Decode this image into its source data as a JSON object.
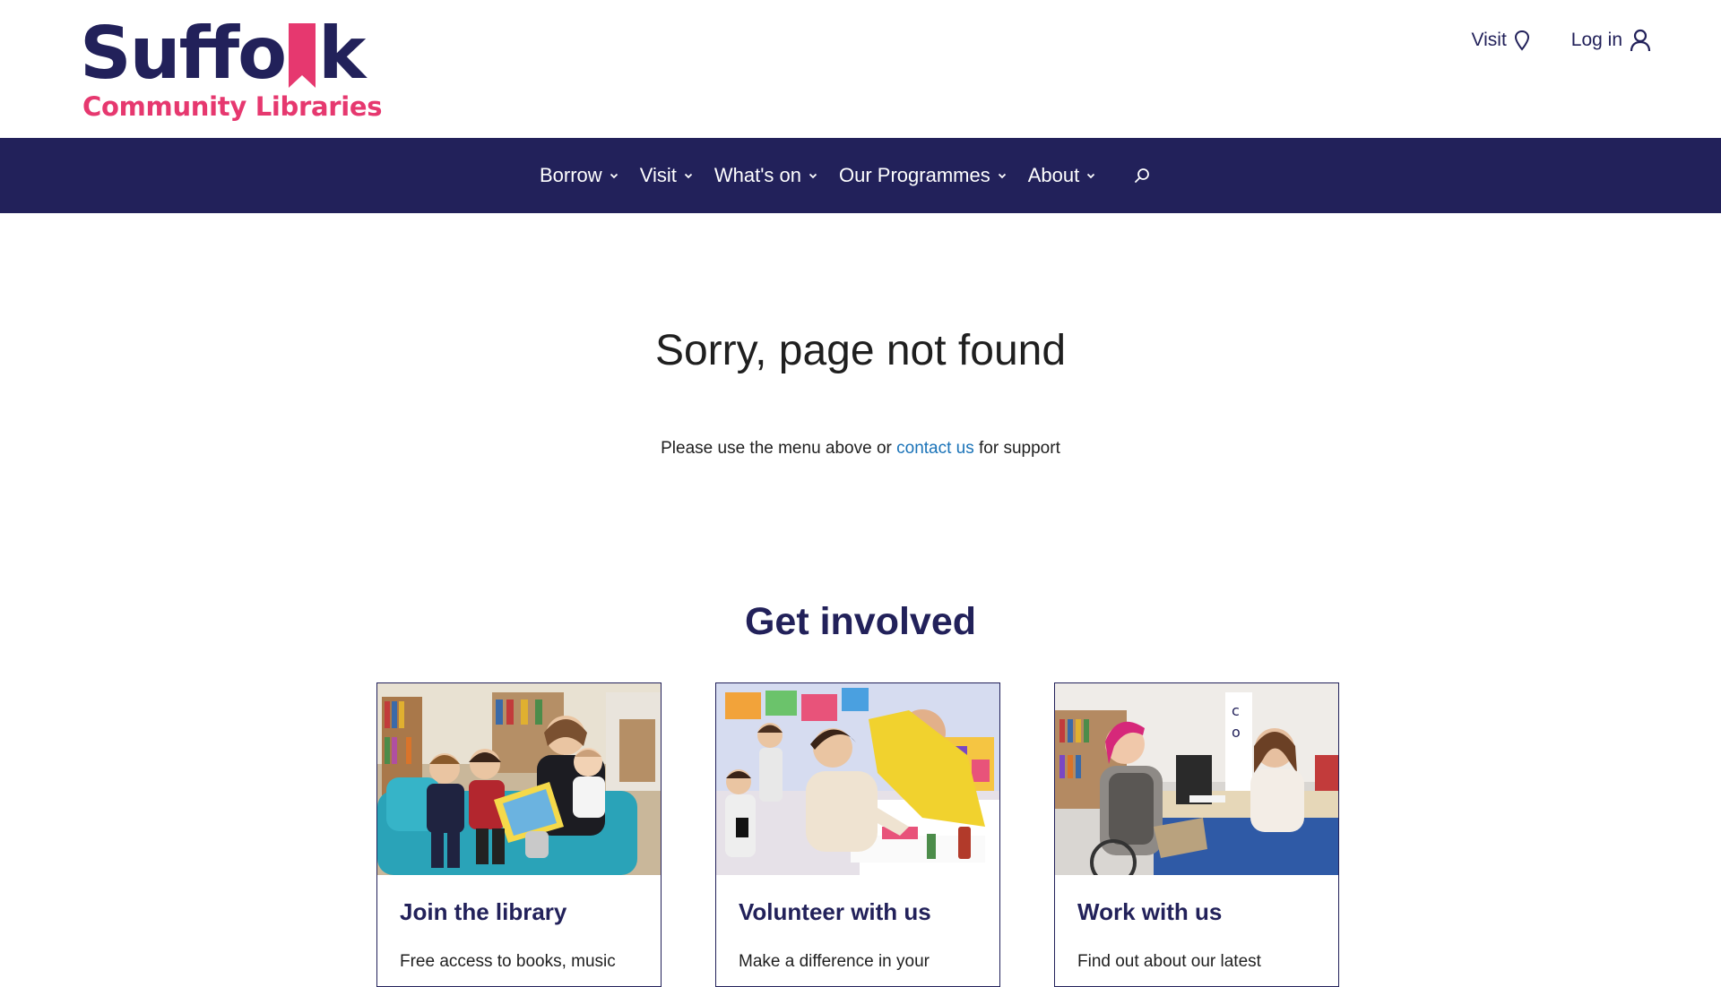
{
  "header": {
    "logo_word_start": "Suffo",
    "logo_word_end": "k",
    "logo_subtitle": "Community Libraries",
    "visit_label": "Visit",
    "login_label": "Log in"
  },
  "nav": {
    "items": [
      {
        "label": "Borrow"
      },
      {
        "label": "Visit"
      },
      {
        "label": "What's on"
      },
      {
        "label": "Our Programmes"
      },
      {
        "label": "About"
      }
    ]
  },
  "main": {
    "title": "Sorry, page not found",
    "support_before": "Please use the menu above or ",
    "support_link": "contact us",
    "support_after": " for support"
  },
  "get_involved": {
    "title": "Get involved",
    "cards": [
      {
        "title": "Join the library",
        "text": "Free access to books, music"
      },
      {
        "title": "Volunteer with us",
        "text": "Make a difference in your"
      },
      {
        "title": "Work with us",
        "text": "Find out about our latest"
      }
    ]
  },
  "colors": {
    "brand_navy": "#22215a",
    "brand_pink": "#e6386f",
    "link_blue": "#1a73b8"
  }
}
